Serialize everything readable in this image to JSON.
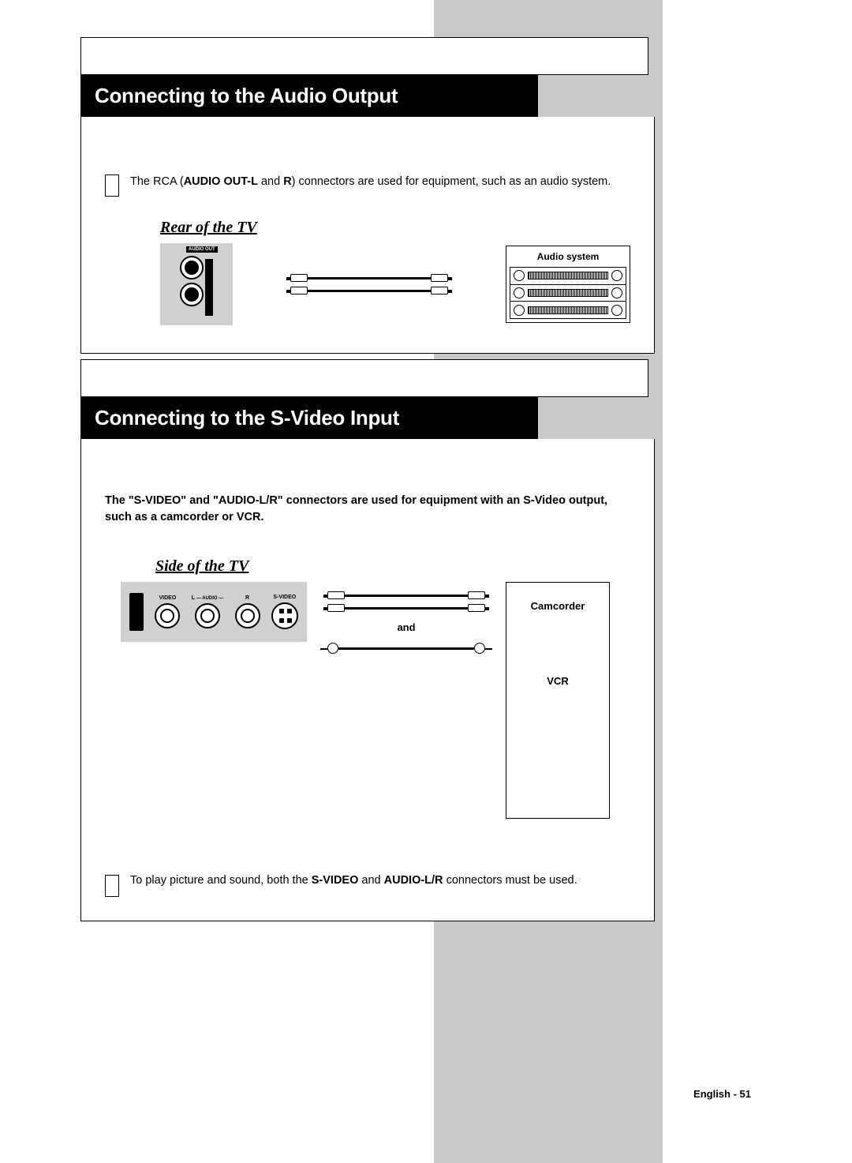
{
  "section1": {
    "title": "Connecting to the Audio Output",
    "intro_pre": "The RCA (",
    "intro_b1": "AUDIO OUT-L",
    "intro_mid1": " and ",
    "intro_b2": "R",
    "intro_post": ") connectors are used for equipment, such as an audio system.",
    "rear_heading": "Rear of the TV",
    "audio_out_label": "AUDIO OUT",
    "device_label": "Audio system"
  },
  "section2": {
    "title": "Connecting to the S-Video Input",
    "intro": "The \"S-VIDEO\" and \"AUDIO-L/R\" connectors are used for equipment with an S-Video output, such as a camcorder or VCR.",
    "side_heading": "Side of the TV",
    "port_video": "VIDEO",
    "port_audio_l": "L",
    "port_audio_dash": "— AUDIO —",
    "port_audio_r": "R",
    "port_svideo": "S-VIDEO",
    "and_label": "and",
    "device_camcorder": "Camcorder",
    "device_vcr": "VCR",
    "note_pre": "To play picture and sound, both the ",
    "note_b1": "S-VIDEO",
    "note_mid": " and ",
    "note_b2": "AUDIO-L/R",
    "note_post": " connectors must be used."
  },
  "footer": "English - 51"
}
